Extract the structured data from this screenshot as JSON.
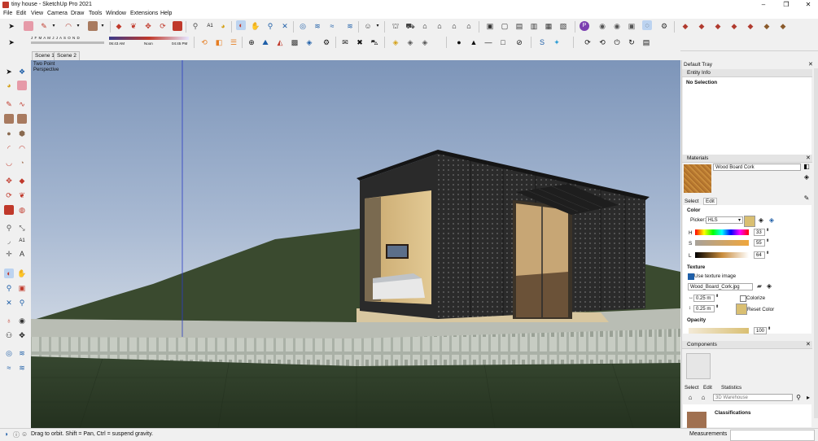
{
  "window": {
    "title": "tiny house - SketchUp Pro 2021",
    "minimize": "–",
    "maximize": "❐",
    "close": "✕"
  },
  "menu": [
    "File",
    "Edit",
    "View",
    "Camera",
    "Draw",
    "Tools",
    "Window",
    "Extensions",
    "Help"
  ],
  "shadow_bar": {
    "months": "J F M A M J J A S O N D",
    "time_start": "06:43 AM",
    "time_noon": "Noon",
    "time_end": "04:45 PM"
  },
  "scenes": [
    "Scene 1",
    "Scene 2"
  ],
  "viewport": {
    "view_line1": "Two Point",
    "view_line2": "Perspective"
  },
  "tray": {
    "title": "Default Tray",
    "entity_info": {
      "header": "Entity Info",
      "selection": "No Selection"
    },
    "materials": {
      "header": "Materials",
      "material_name": "Wood Board Cork",
      "tabs": [
        "Select",
        "Edit"
      ],
      "color_label": "Color",
      "picker_label": "Picker:",
      "picker_value": "HLS",
      "h_label": "H",
      "h_value": "33",
      "s_label": "S",
      "s_value": "55",
      "l_label": "L",
      "l_value": "64",
      "texture_label": "Texture",
      "use_texture": "Use texture image",
      "texture_file": "Wood_Board_Cork.jpg",
      "width": "0.25 m",
      "height": "0.25 m",
      "colorize": "Colorize",
      "reset_color": "Reset Color",
      "opacity_label": "Opacity",
      "opacity_value": "100",
      "swatch_color": "#d9bf72"
    },
    "components": {
      "header": "Components",
      "tabs": [
        "Select",
        "Edit",
        "Statistics"
      ],
      "search_placeholder": "3D Warehouse",
      "classifications": "Classifications"
    }
  },
  "status": {
    "hint": "Drag to orbit. Shift = Pan, Ctrl = suspend gravity.",
    "measurements_label": "Measurements"
  }
}
